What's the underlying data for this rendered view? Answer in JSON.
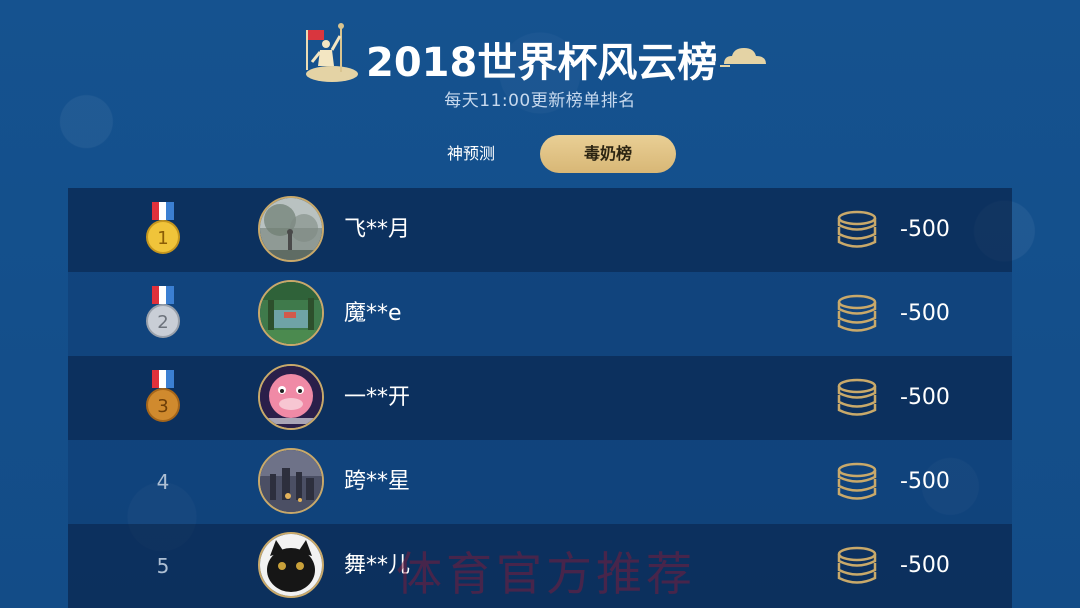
{
  "header": {
    "title": "2018世界杯风云榜",
    "subtitle": "每天11:00更新榜单排名"
  },
  "tabs": [
    {
      "label": "神预测",
      "selected": false
    },
    {
      "label": "毒奶榜",
      "selected": true
    }
  ],
  "colors": {
    "background": "#14508c",
    "accent_gold": "#d8b776",
    "medal_gold": "#f0c43a",
    "medal_silver": "#c9ced6",
    "medal_bronze": "#d08a2e"
  },
  "leaderboard": [
    {
      "rank": "1",
      "medal": "gold",
      "name": "飞**月",
      "score": "-500"
    },
    {
      "rank": "2",
      "medal": "silver",
      "name": "魔**e",
      "score": "-500"
    },
    {
      "rank": "3",
      "medal": "bronze",
      "name": "一**开",
      "score": "-500"
    },
    {
      "rank": "4",
      "medal": "none",
      "name": "跨**星",
      "score": "-500"
    },
    {
      "rank": "5",
      "medal": "none",
      "name": "舞**儿",
      "score": "-500"
    }
  ],
  "icons": {
    "title": "trophy-player-icon",
    "cloud": "cloud-icon",
    "medal": "medal-icon",
    "coin": "coin-stack-icon"
  },
  "watermark": "体育官方推荐"
}
